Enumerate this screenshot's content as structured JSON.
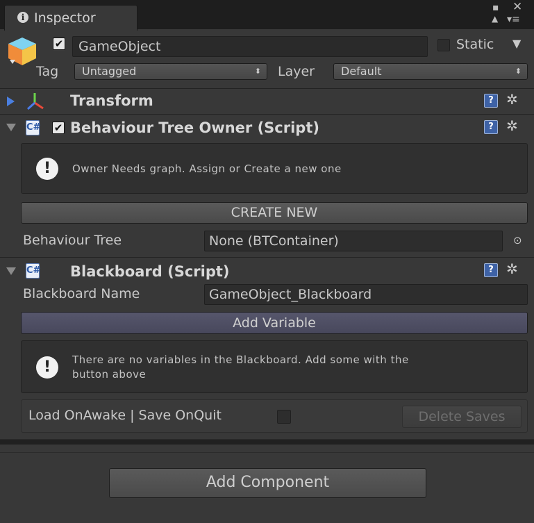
{
  "tab": {
    "title": "Inspector",
    "info_glyph": "i"
  },
  "window_controls": {
    "maximize_glyph": "▪",
    "close_glyph": "✕",
    "lock_glyph": "▲",
    "menu_glyph": "▾≡"
  },
  "header": {
    "active_checked": true,
    "name": "GameObject",
    "static_label": "Static",
    "static_checked": false,
    "tag_label": "Tag",
    "tag_value": "Untagged",
    "layer_label": "Layer",
    "layer_value": "Default"
  },
  "transform": {
    "title": "Transform"
  },
  "bt_owner": {
    "title": "Behaviour Tree Owner (Script)",
    "enabled": true,
    "help_message": "Owner Needs graph. Assign or Create a new one",
    "create_button": "CREATE NEW",
    "field_label": "Behaviour Tree",
    "field_value": "None (BTContainer)"
  },
  "blackboard": {
    "title": "Blackboard (Script)",
    "name_label": "Blackboard Name",
    "name_value": "GameObject_Blackboard",
    "add_variable_button": "Add Variable",
    "help_line1": "There are no variables in the Blackboard. Add some with the",
    "help_line2": "button above",
    "load_save_label": "Load OnAwake | Save OnQuit",
    "load_save_checked": false,
    "delete_saves_button": "Delete Saves"
  },
  "add_component_button": "Add Component",
  "icons": {
    "help": "?",
    "gear": "✲",
    "script": "C#",
    "warning": "!",
    "object_picker": "⊙",
    "check": "✔"
  },
  "colors": {
    "background": "#383838",
    "tabbar": "#1e1e1e",
    "field": "#2a2a2a",
    "accent_button": "#4c4c60"
  }
}
